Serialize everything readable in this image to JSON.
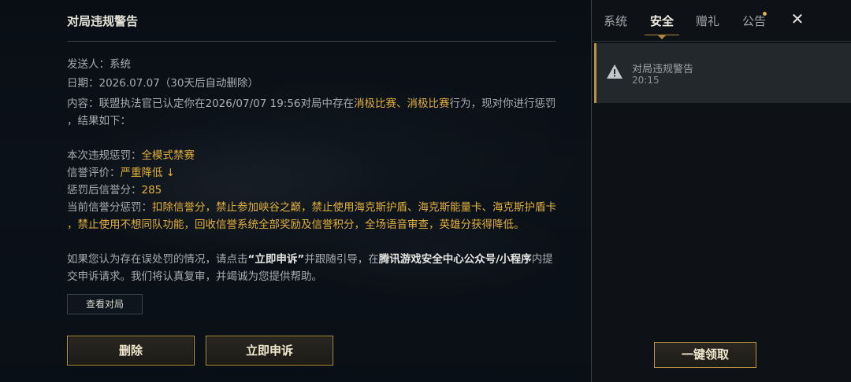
{
  "mail": {
    "title": "对局违规警告",
    "sender": "发送人：系统",
    "date": "日期：2026.07.07（30天后自动删除）",
    "content_line1_a": "内容：联盟执法官已认定你在2026/07/07 19:56对局中存在",
    "content_line1_b": "消极比赛",
    "content_line1_c": "、",
    "content_line1_d": "消极比赛",
    "content_line1_e": "行为，现对你进行惩罚",
    "content_line2": "，结果如下：",
    "penalty_label": "本次违规惩罚：",
    "penalty_value": "全模式禁赛",
    "rating_label": "信誉评价：",
    "rating_value": "严重降低 ↓",
    "score_label": "惩罚后信誉分：",
    "score_value": "285",
    "current_label": "当前信誉分惩罚：",
    "current_value_line1": "扣除信誉分，禁止参加峡谷之巅，禁止使用海克斯护盾、海克斯能量卡、海克斯护盾卡",
    "current_value_line2": "，禁止使用不想同队功能，回收信誉系统全部奖励及信誉积分，全场语音审查，英雄分获得降低。",
    "appeal_a": "如果您认为存在误处罚的情况，请点击",
    "appeal_b": "“立即申诉”",
    "appeal_c": "并跟随引导，在",
    "appeal_d": "腾讯游戏安全中心公众号/小程序",
    "appeal_e": "内提",
    "appeal_line2": "交申诉请求。我们将认真复审，并竭诚为您提供帮助。",
    "view_match_label": "查看对局",
    "delete_label": "删除",
    "appeal_button_label": "立即申诉"
  },
  "tabs": [
    {
      "label": "系统",
      "active": false
    },
    {
      "label": "安全",
      "active": true
    },
    {
      "label": "赠礼",
      "active": false
    },
    {
      "label": "公告",
      "active": false,
      "has_dot": true
    }
  ],
  "close_icon": "close-icon",
  "inbox": {
    "items": [
      {
        "title": "对局违规警告",
        "time": "20:15",
        "icon": "warning-icon"
      }
    ],
    "claim_all_label": "一键领取"
  },
  "colors": {
    "accent_gold": "#e3b13a",
    "border_gold": "#b8963d"
  }
}
